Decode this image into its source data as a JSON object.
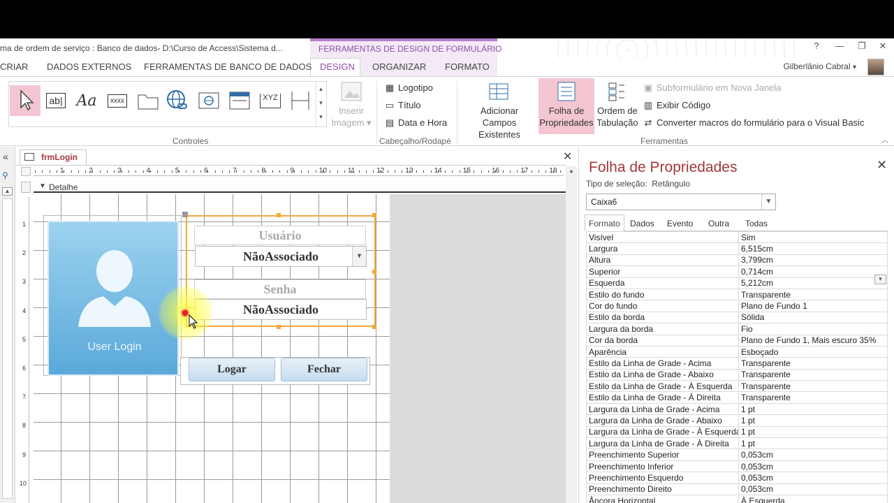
{
  "window": {
    "title": "ma de ordem de serviço : Banco de dados- D:\\Curso de Access\\Sistema d...",
    "context_header": "FERRAMENTAS DE DESIGN DE FORMULÁRIO",
    "help": "?",
    "minimize": "—",
    "restore": "❐",
    "close": "✕"
  },
  "tabs": [
    "CRIAR",
    "DADOS EXTERNOS",
    "FERRAMENTAS DE BANCO DE DADOS",
    "DESIGN",
    "ORGANIZAR",
    "FORMATO"
  ],
  "user": {
    "name": "Gilberlânio Cabral",
    "dropdown": "▾"
  },
  "ribbon": {
    "controles": {
      "label": "Controles",
      "items": [
        "ab|",
        "Aa",
        "xxxx",
        "XYZ"
      ],
      "insert_image": [
        "Inserir",
        "Imagem ▾"
      ]
    },
    "cabecalho": {
      "label": "Cabeçalho/Rodapé",
      "logo": "Logotipo",
      "titulo": "Título",
      "datahora": "Data e Hora"
    },
    "ferramentas": {
      "label": "Ferramentas",
      "adicionar": [
        "Adicionar",
        "Campos Existentes"
      ],
      "folha": [
        "Folha de",
        "Propriedades"
      ],
      "ordem": [
        "Ordem de",
        "Tabulação"
      ],
      "subform": "Subformulário em Nova Janela",
      "exibir": "Exibir Código",
      "converter": "Converter macros do formulário para o Visual Basic"
    }
  },
  "document": {
    "tab": "frmLogin",
    "close": "✕",
    "section": "Detalhe",
    "ruler_numbers": [
      "1",
      "2",
      "3",
      "4",
      "5",
      "6",
      "7",
      "8",
      "9",
      "10",
      "11",
      "12",
      "13",
      "14",
      "15",
      "16",
      "17",
      "18"
    ],
    "vruler_numbers": [
      "1",
      "2",
      "3",
      "4",
      "5",
      "6",
      "7",
      "8",
      "9",
      "10"
    ]
  },
  "form": {
    "user_card_label": "User Login",
    "usuario_label": "Usuário",
    "usuario_combo": "NãoAssociado",
    "senha_label": "Senha",
    "senha_field": "NãoAssociado",
    "logar_button": "Logar",
    "fechar_button": "Fechar"
  },
  "properties": {
    "title": "Folha de Propriedades",
    "close": "✕",
    "selection_type_label": "Tipo de seleção:",
    "selection_type": "Retângulo",
    "object": "Caixa6",
    "tabs": [
      "Formato",
      "Dados",
      "Evento",
      "Outra",
      "Todas"
    ],
    "rows": [
      [
        "Visível",
        "Sim"
      ],
      [
        "Largura",
        "6,515cm"
      ],
      [
        "Altura",
        "3,799cm"
      ],
      [
        "Superior",
        "0,714cm"
      ],
      [
        "Esquerda",
        "5,212cm"
      ],
      [
        "Estilo do fundo",
        "Transparente"
      ],
      [
        "Cor do fundo",
        "Plano de Fundo 1"
      ],
      [
        "Estilo da borda",
        "Sólida"
      ],
      [
        "Largura da borda",
        "Fio"
      ],
      [
        "Cor da borda",
        "Plano de Fundo 1, Mais escuro 35%"
      ],
      [
        "Aparência",
        "Esboçado"
      ],
      [
        "Estilo da Linha de Grade - Acima",
        "Transparente"
      ],
      [
        "Estilo da Linha de Grade - Abaixo",
        "Transparente"
      ],
      [
        "Estilo da Linha de Grade - À Esquerda",
        "Transparente"
      ],
      [
        "Estilo da Linha de Grade - À Direita",
        "Transparente"
      ],
      [
        "Largura da Linha de Grade - Acima",
        "1 pt"
      ],
      [
        "Largura da Linha de Grade - Abaixo",
        "1 pt"
      ],
      [
        "Largura da Linha de Grade - À Esquerda",
        "1 pt"
      ],
      [
        "Largura da Linha de Grade - À Direita",
        "1 pt"
      ],
      [
        "Preenchimento Superior",
        "0,053cm"
      ],
      [
        "Preenchimento Inferior",
        "0,053cm"
      ],
      [
        "Preenchimento Esquerdo",
        "0,053cm"
      ],
      [
        "Preenchimento Direito",
        "0,053cm"
      ],
      [
        "Âncora Horizontal",
        "À Esquerda"
      ]
    ]
  },
  "colors": {
    "accent": "#a4373a",
    "context": "#b57fc8",
    "selection": "#f2a936"
  }
}
